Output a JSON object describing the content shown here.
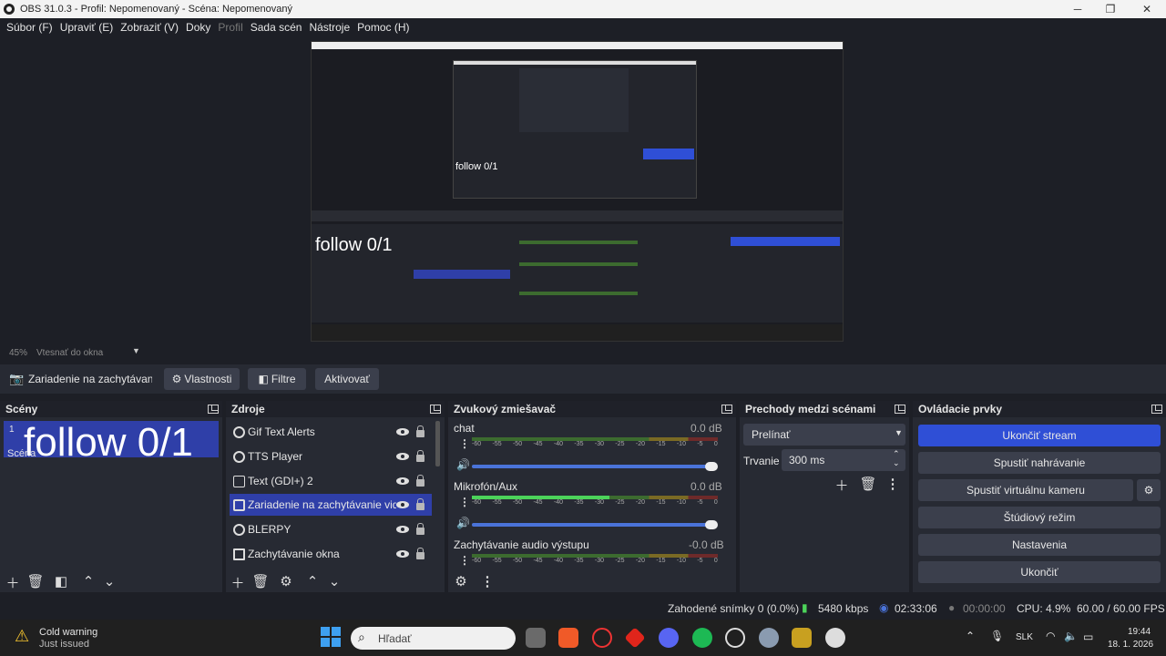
{
  "window": {
    "title": "OBS 31.0.3 - Profil: Nepomenovaný - Scéna: Nepomenovaný"
  },
  "menu": [
    "Súbor (F)",
    "Upraviť (E)",
    "Zobraziť (V)",
    "Doky",
    "Profil",
    "Sada scén",
    "Nástroje",
    "Pomoc (H)"
  ],
  "preview": {
    "zoom": "45%",
    "fit": "Vtesnať do okna",
    "mini_text": "follow 0/1"
  },
  "source_bar": {
    "selected": "Zariadenie na zachytávanie",
    "properties": "Vlastnosti",
    "filters": "Filtre",
    "activate": "Aktivovať"
  },
  "scenes": {
    "title": "Scény",
    "overlay_text": "follow 0/1",
    "item": "Scéna",
    "item_number": "1"
  },
  "sources": {
    "title": "Zdroje",
    "items": [
      "Gif Text Alerts",
      "TTS Player",
      "Text (GDI+) 2",
      "Zariadenie na zachytávanie videa",
      "BLERPY",
      "Zachytávanie okna"
    ]
  },
  "mixer": {
    "title": "Zvukový zmiešavač",
    "scale": [
      "-60",
      "-55",
      "-50",
      "-45",
      "-40",
      "-35",
      "-30",
      "-25",
      "-20",
      "-15",
      "-10",
      "-5",
      "0"
    ],
    "channels": [
      {
        "name": "chat",
        "level": "0.0 dB"
      },
      {
        "name": "Mikrofón/Aux",
        "level": "0.0 dB"
      },
      {
        "name": "Zachytávanie audio výstupu",
        "level": "-0.0 dB"
      }
    ]
  },
  "transitions": {
    "title": "Prechody medzi scénami",
    "type": "Prelínať",
    "duration_label": "Trvanie",
    "duration": "300 ms"
  },
  "controls": {
    "title": "Ovládacie prvky",
    "buttons": [
      "Ukončiť stream",
      "Spustiť nahrávanie",
      "Spustiť virtuálnu kameru",
      "Štúdiový režim",
      "Nastavenia",
      "Ukončiť"
    ]
  },
  "status": {
    "dropped": "Zahodené snímky 0 (0.0%)",
    "bitrate": "5480 kbps",
    "stream_time": "02:33:06",
    "rec_time": "00:00:00",
    "cpu": "CPU: 4.9%",
    "fps": "60.00 / 60.00 FPS"
  },
  "taskbar": {
    "warning_title": "Cold warning",
    "warning_sub": "Just issued",
    "search": "Hľadať",
    "lang": "SLK",
    "time": "19:44",
    "date": "18. 1. 2026"
  },
  "colors": {
    "accent": "#2f4fd6",
    "selection": "#2f3fa8",
    "panel": "#272a33",
    "bg": "#1d1f26"
  }
}
